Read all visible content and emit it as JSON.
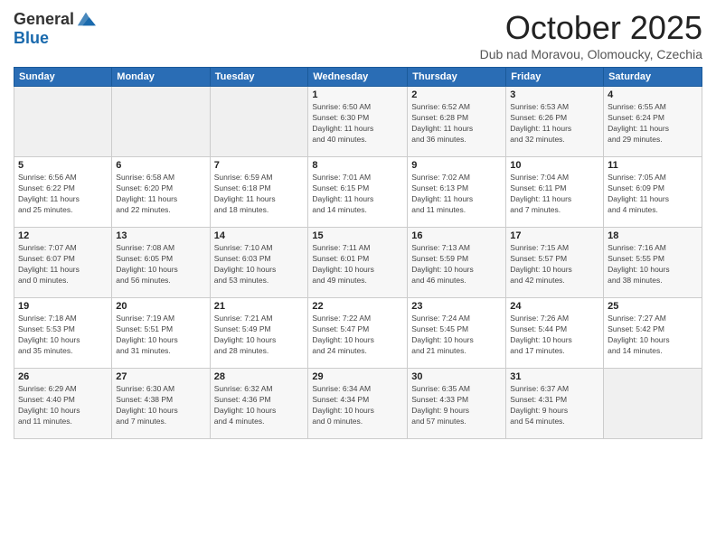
{
  "logo": {
    "general": "General",
    "blue": "Blue"
  },
  "calendar": {
    "title": "October 2025",
    "location": "Dub nad Moravou, Olomoucky, Czechia",
    "days_of_week": [
      "Sunday",
      "Monday",
      "Tuesday",
      "Wednesday",
      "Thursday",
      "Friday",
      "Saturday"
    ]
  }
}
